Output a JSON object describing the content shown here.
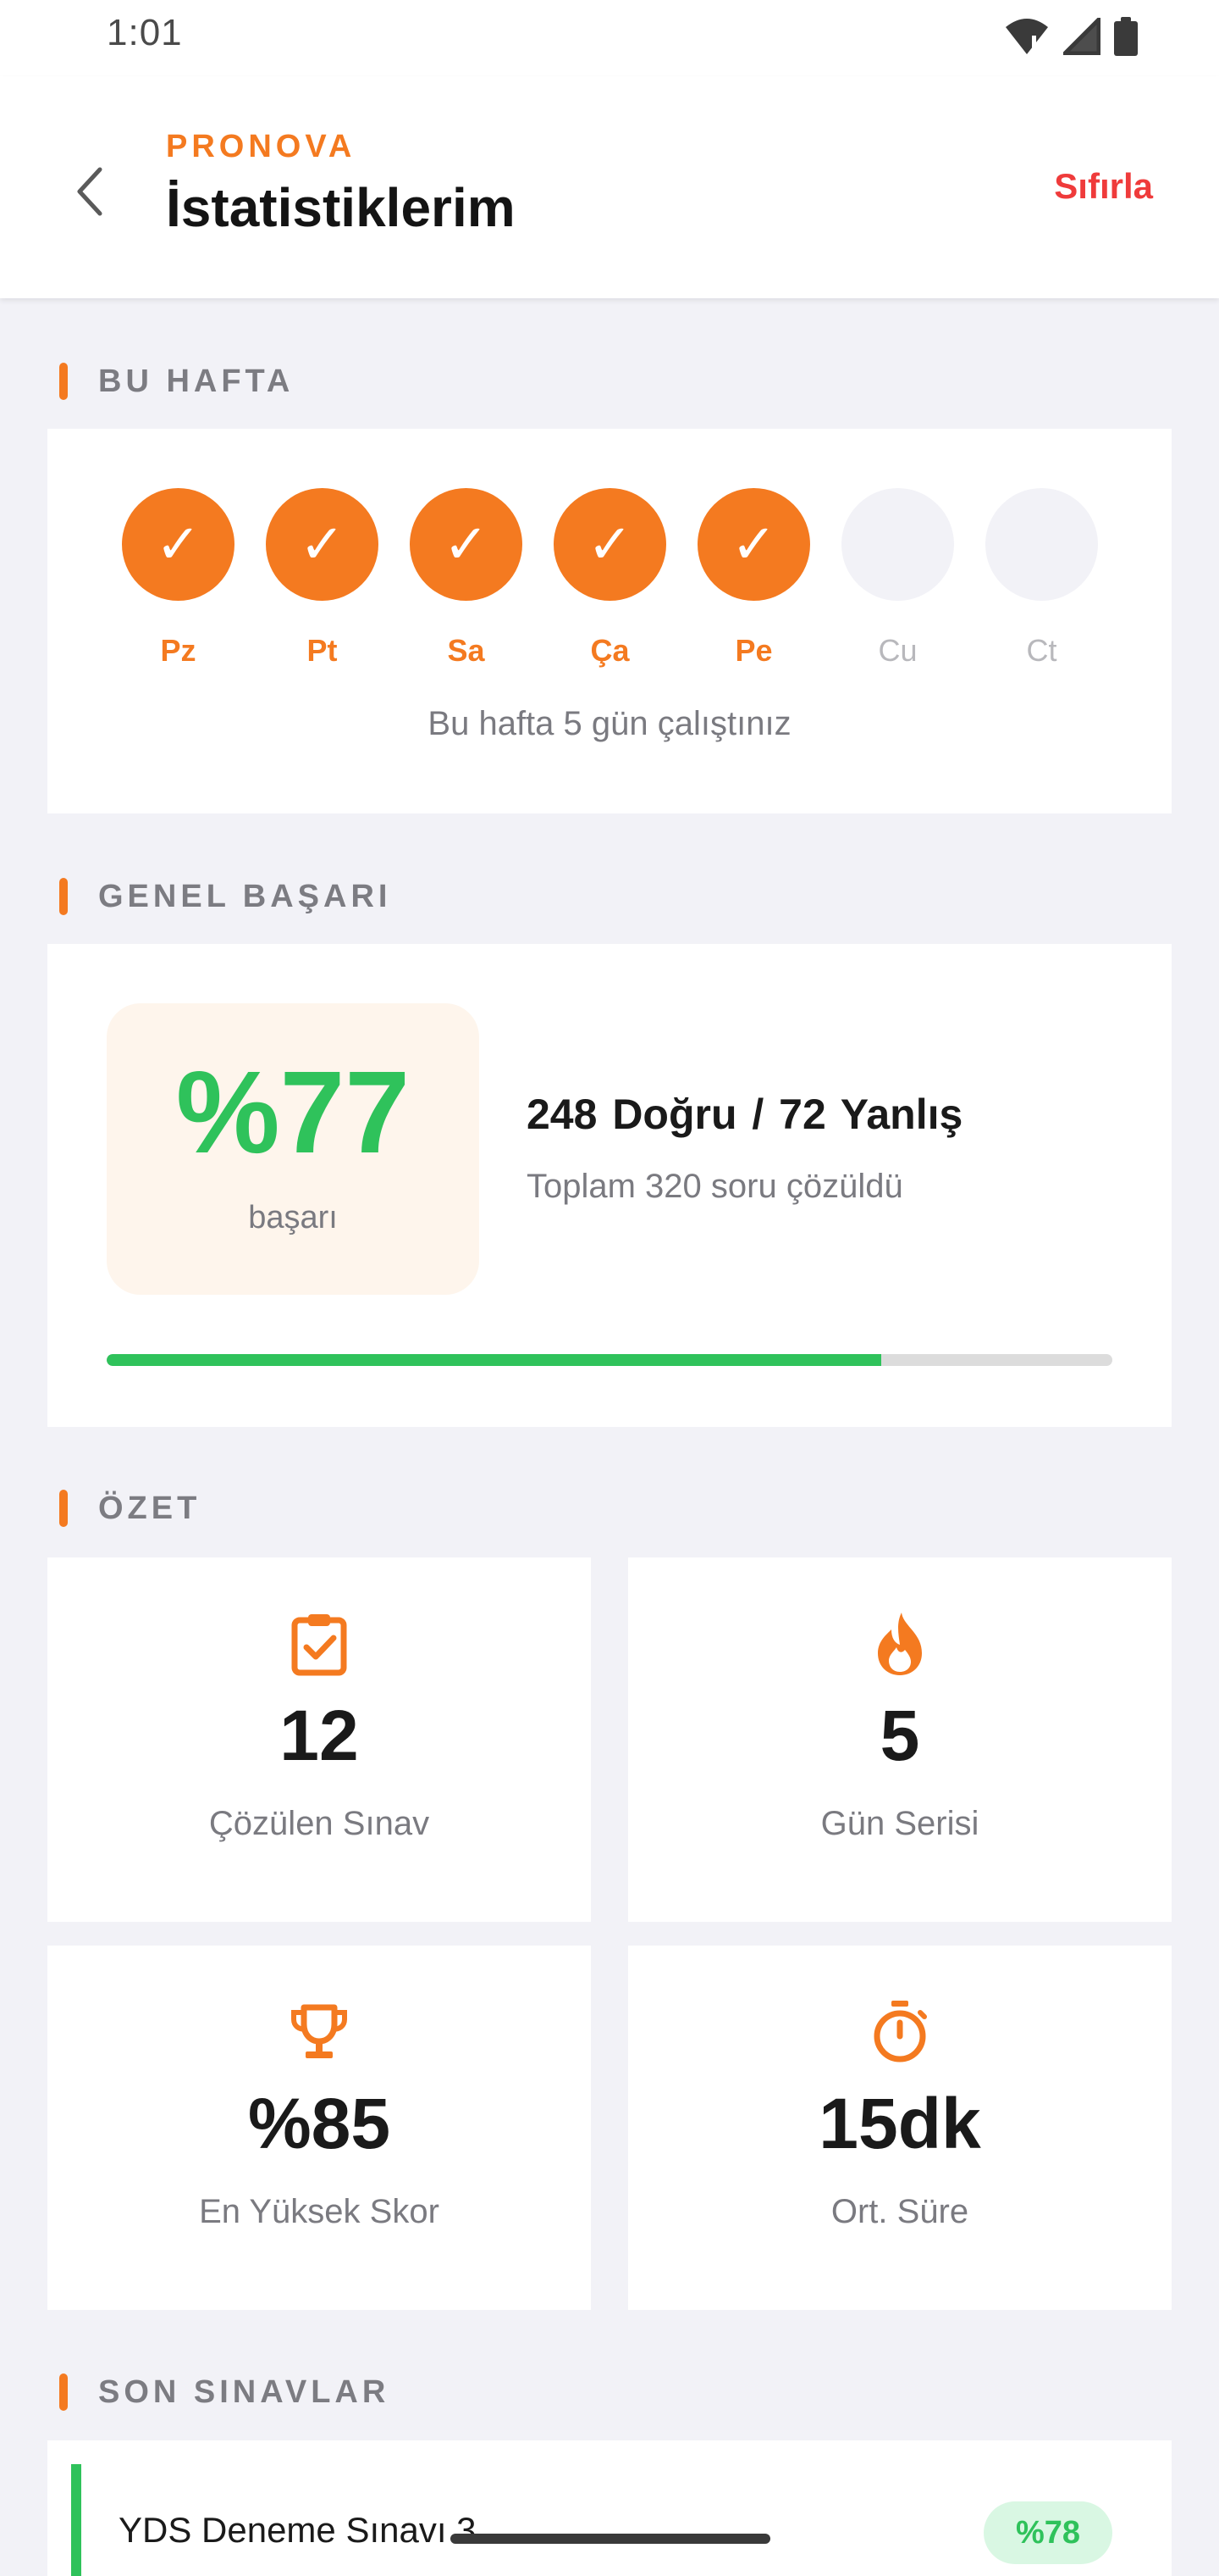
{
  "status_bar": {
    "time": "1:01"
  },
  "header": {
    "brand": "PRONOVA",
    "title": "İstatistiklerim",
    "reset_label": "Sıfırla"
  },
  "week": {
    "section_title": "BU HAFTA",
    "days": [
      {
        "label": "Pz",
        "done": true
      },
      {
        "label": "Pt",
        "done": true
      },
      {
        "label": "Sa",
        "done": true
      },
      {
        "label": "Ça",
        "done": true
      },
      {
        "label": "Pe",
        "done": true
      },
      {
        "label": "Cu",
        "done": false
      },
      {
        "label": "Ct",
        "done": false
      }
    ],
    "check_glyph": "✓",
    "summary": "Bu hafta 5 gün çalıştınız"
  },
  "success": {
    "section_title": "GENEL BAŞARI",
    "score": "%77",
    "score_label": "başarı",
    "counts": "248 Doğru  /  72 Yanlış",
    "total": "Toplam 320 soru çözüldü",
    "progress_percent": 77
  },
  "summary": {
    "section_title": "ÖZET",
    "stats": [
      {
        "icon": "clipboard-check-icon",
        "value": "12",
        "label": "Çözülen Sınav"
      },
      {
        "icon": "fire-icon",
        "value": "5",
        "label": "Gün Serisi"
      },
      {
        "icon": "trophy-icon",
        "value": "%85",
        "label": "En Yüksek Skor"
      },
      {
        "icon": "timer-icon",
        "value": "15dk",
        "label": "Ort. Süre"
      }
    ]
  },
  "recent": {
    "section_title": "SON SINAVLAR",
    "items": [
      {
        "name": "YDS Deneme Sınavı 3",
        "score": "%78"
      }
    ]
  },
  "colors": {
    "accent": "#f47a20",
    "success": "#2fc25b",
    "danger": "#ef3b3b",
    "background": "#f2f2f7"
  }
}
